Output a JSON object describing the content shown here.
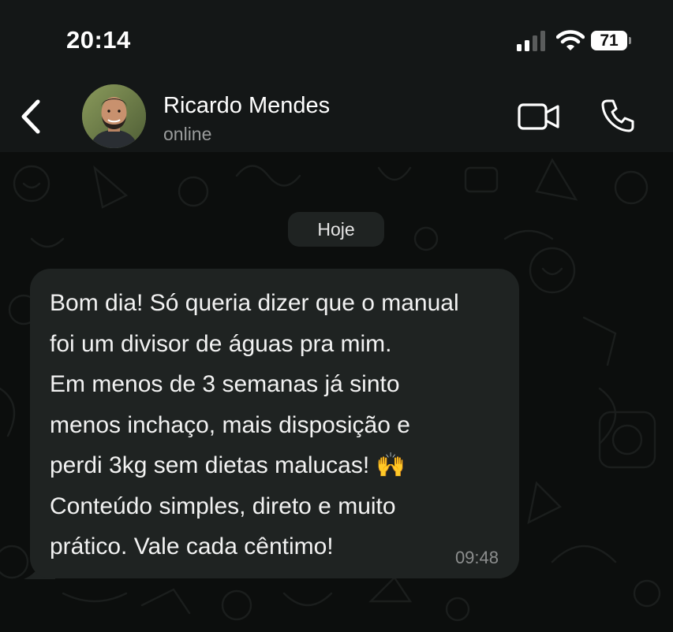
{
  "status_bar": {
    "time": "20:14",
    "battery": "71",
    "icons": [
      "cellular-signal-icon",
      "wifi-icon",
      "battery-icon"
    ]
  },
  "header": {
    "back_icon": "chevron-left-icon",
    "contact_name": "Ricardo Mendes",
    "contact_status": "online",
    "actions": [
      "video-call-icon",
      "phone-call-icon"
    ]
  },
  "chat": {
    "date_label": "Hoje",
    "messages": [
      {
        "lines": [
          "Bom dia! Só queria dizer que o manual",
          "foi um divisor de águas pra mim.",
          "Em menos de 3 semanas já sinto",
          "menos inchaço, mais disposição e",
          "perdi 3kg sem dietas malucas!",
          "Conteúdo simples, direto e muito",
          "prático. Vale cada cêntimo!"
        ],
        "emoji": "🙌",
        "time": "09:48"
      }
    ]
  },
  "colors": {
    "header_bg": "#141717",
    "chat_bg": "#0c0e0d",
    "bubble_bg": "#1f2322",
    "secondary_text": "#9a9c9c"
  }
}
